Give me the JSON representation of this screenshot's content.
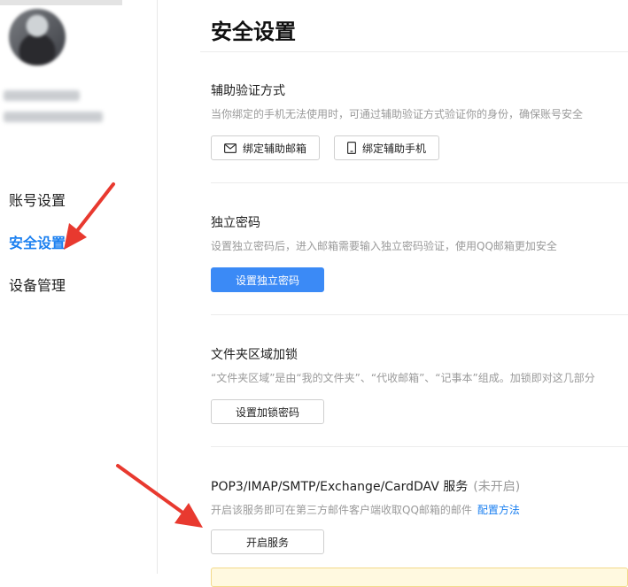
{
  "sidebar": {
    "items": [
      {
        "label": "账号设置",
        "active": false
      },
      {
        "label": "安全设置",
        "active": true
      },
      {
        "label": "设备管理",
        "active": false
      }
    ]
  },
  "main": {
    "title": "安全设置",
    "sections": [
      {
        "title": "辅助验证方式",
        "desc": "当你绑定的手机无法使用时，可通过辅助验证方式验证你的身份，确保账号安全",
        "buttons": [
          {
            "label": "绑定辅助邮箱",
            "icon": "mail-icon"
          },
          {
            "label": "绑定辅助手机",
            "icon": "phone-icon"
          }
        ]
      },
      {
        "title": "独立密码",
        "desc": "设置独立密码后，进入邮箱需要输入独立密码验证，使用QQ邮箱更加安全",
        "buttons": [
          {
            "label": "设置独立密码"
          }
        ]
      },
      {
        "title": "文件夹区域加锁",
        "desc": "“文件夹区域”是由“我的文件夹”、“代收邮箱”、“记事本”组成。加锁即对这几部分",
        "buttons": [
          {
            "label": "设置加锁密码"
          }
        ]
      },
      {
        "title": "POP3/IMAP/SMTP/Exchange/CardDAV 服务",
        "status": "(未开启)",
        "desc": "开启该服务即可在第三方邮件客户端收取QQ邮箱的邮件",
        "link": "配置方法",
        "buttons": [
          {
            "label": "开启服务"
          }
        ]
      }
    ]
  },
  "colors": {
    "accent": "#1a7ff0",
    "primary_button": "#3b8af6",
    "arrow": "#e8392f"
  }
}
